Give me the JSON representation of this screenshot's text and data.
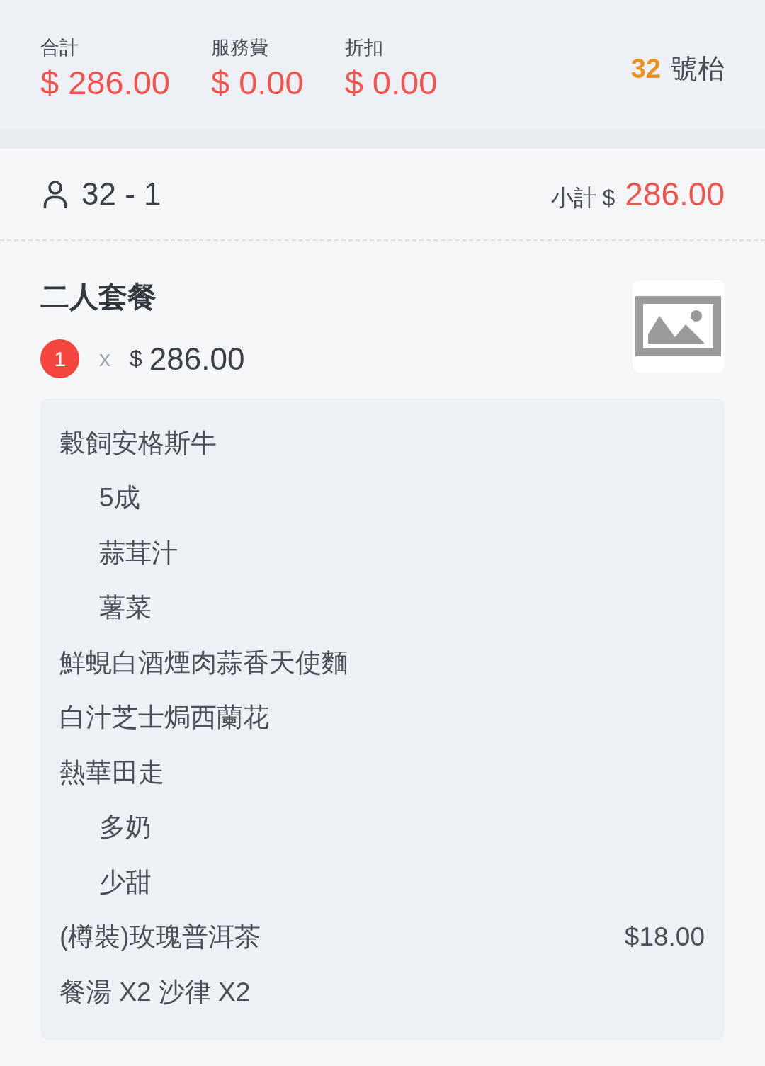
{
  "summary": [
    {
      "label": "合計",
      "amount": "$ 286.00"
    },
    {
      "label": "服務費",
      "amount": "$ 0.00"
    },
    {
      "label": "折扣",
      "amount": "$ 0.00"
    }
  ],
  "table": {
    "number": "32",
    "label": "號枱"
  },
  "seat": {
    "label": "32 - 1",
    "subtotal_label": "小計 $",
    "subtotal": "286.00"
  },
  "items": [
    {
      "name": "二人套餐",
      "quantity": "1",
      "times": "x",
      "currency": "$",
      "price": "286.00",
      "details": [
        {
          "text": "穀飼安格斯牛",
          "children": [
            {
              "text": "5成"
            },
            {
              "text": "蒜茸汁"
            },
            {
              "text": "薯菜"
            }
          ]
        },
        {
          "text": "鮮蜆白酒煙肉蒜香天使麵"
        },
        {
          "text": "白汁芝士焗西蘭花"
        },
        {
          "text": "熱華田走",
          "children": [
            {
              "text": "多奶"
            },
            {
              "text": "少甜"
            }
          ]
        },
        {
          "text": "(樽裝)玫瑰普洱茶",
          "price": "$18.00"
        },
        {
          "text": "餐湯 X2 沙律 X2"
        }
      ]
    }
  ]
}
